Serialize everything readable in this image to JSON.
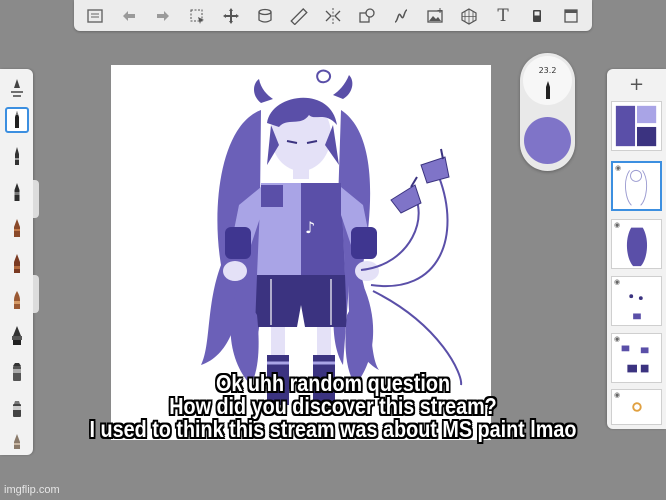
{
  "top_toolbar": {
    "tools": [
      {
        "icon": "list-icon"
      },
      {
        "icon": "undo-icon"
      },
      {
        "icon": "redo-icon"
      },
      {
        "icon": "selection-icon"
      },
      {
        "icon": "transform-icon"
      },
      {
        "icon": "layer-stack-icon"
      },
      {
        "icon": "ruler-icon"
      },
      {
        "icon": "symmetry-icon"
      },
      {
        "icon": "shape-icon"
      },
      {
        "icon": "curve-icon"
      },
      {
        "icon": "image-icon"
      },
      {
        "icon": "perspective-icon"
      },
      {
        "icon": "text-icon",
        "glyph": "T"
      },
      {
        "icon": "fill-icon"
      },
      {
        "icon": "fullscreen-icon"
      }
    ]
  },
  "brush_panel": {
    "brushes": [
      "brush-add-icon",
      "pen-icon",
      "pencil-icon",
      "marker-icon",
      "crayon-icon",
      "airbrush-icon",
      "paintbrush-icon",
      "inkpen-icon",
      "chisel-icon",
      "eraser-icon",
      "smudge-icon",
      "blender-icon"
    ],
    "selected_index": 1
  },
  "puck": {
    "brush_size": "23.2",
    "color": "#7f74c8"
  },
  "layers": {
    "add_glyph": "+",
    "selected_index": 1
  },
  "colors": {
    "accent": "#3c8fe0",
    "character_purple": "#5a4fa8",
    "character_light": "#a9a4e6"
  },
  "caption": {
    "line1": "Ok uhh random question",
    "line2": "How did you discover this stream?",
    "line3": "I used to think this stream was about MS paint lmao"
  },
  "watermark": "imgflip.com"
}
